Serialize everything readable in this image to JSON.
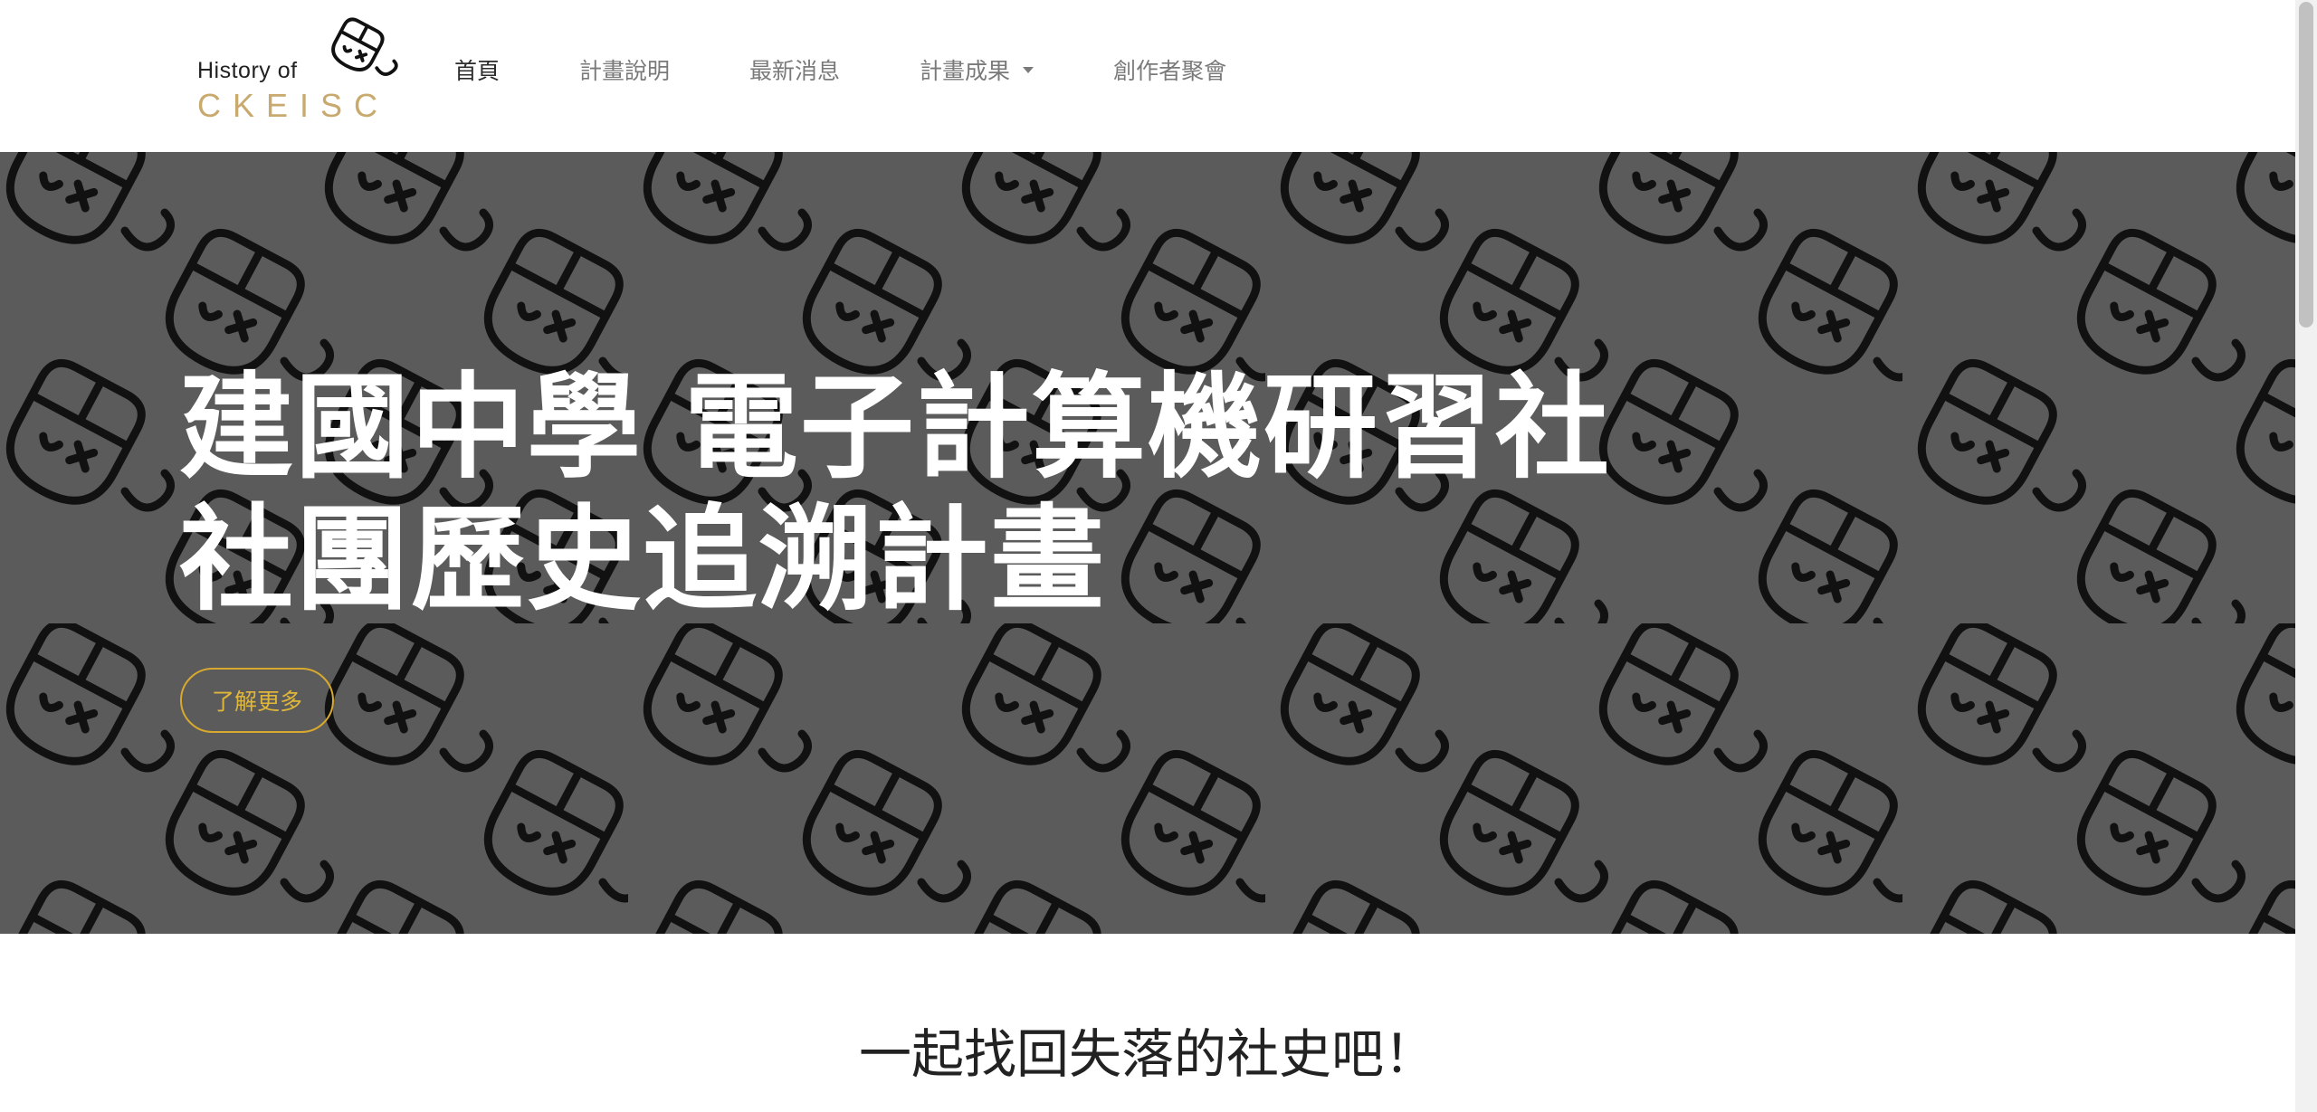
{
  "brand": {
    "line1": "History of",
    "line2": "CKEISC",
    "accent_color": "#c8a96e"
  },
  "nav": {
    "items": [
      {
        "label": "首頁",
        "active": true
      },
      {
        "label": "計畫說明"
      },
      {
        "label": "最新消息"
      },
      {
        "label": "計畫成果",
        "icon": "caret-down-icon"
      },
      {
        "label": "創作者聚會"
      }
    ]
  },
  "hero": {
    "title_line1": "建國中學  電子計算機研習社",
    "title_line2": "社團歷史追溯計畫",
    "cta_label": "了解更多",
    "background_color": "#5b5b5b",
    "pattern_icon": "mouse-mascot-icon",
    "cta_color": "#d8a92e"
  },
  "section": {
    "heading": "一起找回失落的社史吧！"
  }
}
